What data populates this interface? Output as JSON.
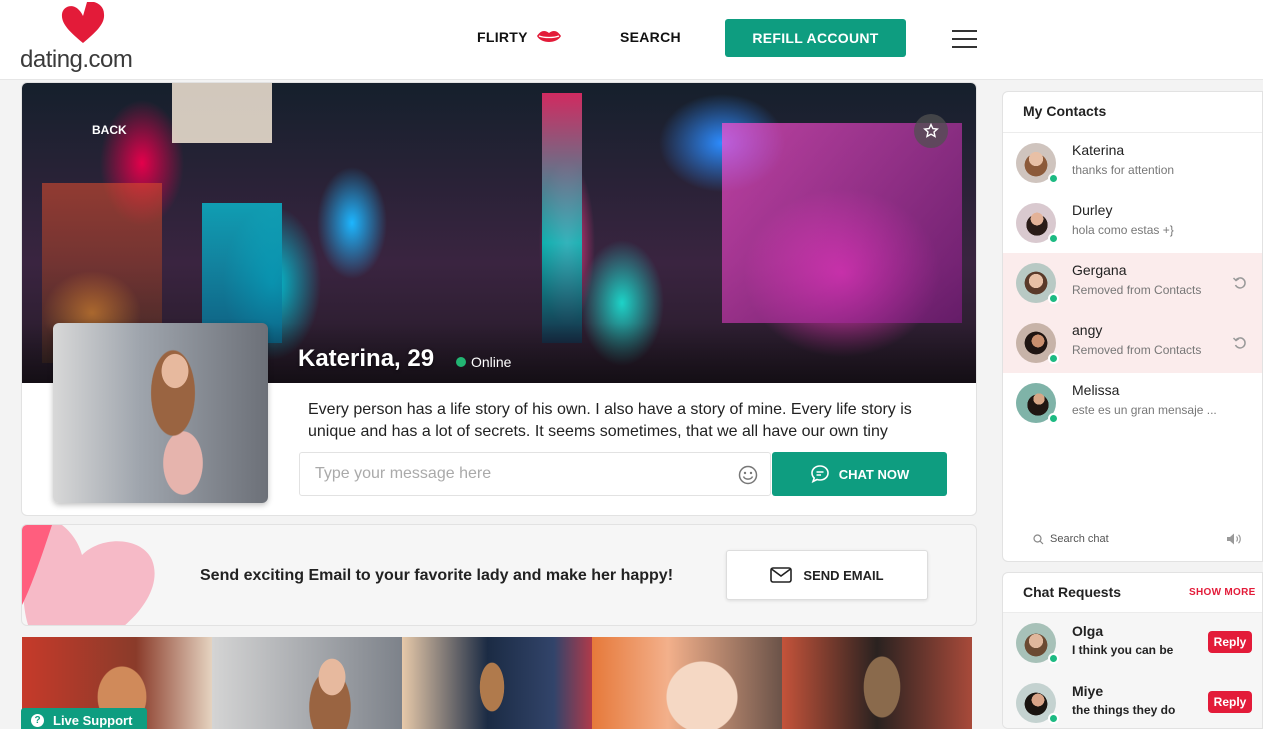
{
  "header": {
    "logo_text": "dating.com",
    "nav_flirty": "FLIRTY",
    "nav_search": "SEARCH",
    "refill_label": "REFILL ACCOUNT"
  },
  "colors": {
    "accent_green": "#0e9d80",
    "brand_red": "#e31b39",
    "online_green": "#22b573"
  },
  "profile": {
    "back_label": "BACK",
    "name_age": "Katerina, 29",
    "status": "Online",
    "bio": "Every person has a life story of his own. I also have a story of mine. Every life story is unique and has a lot of secrets. It seems sometimes, that we all have our own tiny",
    "message_placeholder": "Type your message here",
    "chat_now_label": "CHAT NOW"
  },
  "email_banner": {
    "text": "Send exciting Email to your favorite lady and make her happy!",
    "button_label": "SEND EMAIL"
  },
  "live_support_label": "Live Support",
  "contacts": {
    "title": "My Contacts",
    "items": [
      {
        "name": "Katerina",
        "message": "thanks for attention",
        "removed": false
      },
      {
        "name": "Durley",
        "message": "hola como estas +}",
        "removed": false
      },
      {
        "name": "Gergana",
        "message": "Removed from Contacts",
        "removed": true
      },
      {
        "name": "angy",
        "message": "Removed from Contacts",
        "removed": true
      },
      {
        "name": "Melissa",
        "message": "este es un gran mensaje ...",
        "removed": false
      }
    ],
    "search_label": "Search chat"
  },
  "chat_requests": {
    "title": "Chat Requests",
    "show_more_label": "SHOW MORE",
    "items": [
      {
        "name": "Olga",
        "message": "I think you can be",
        "reply_label": "Reply"
      },
      {
        "name": "Miye",
        "message": "the things they do",
        "reply_label": "Reply"
      }
    ]
  }
}
